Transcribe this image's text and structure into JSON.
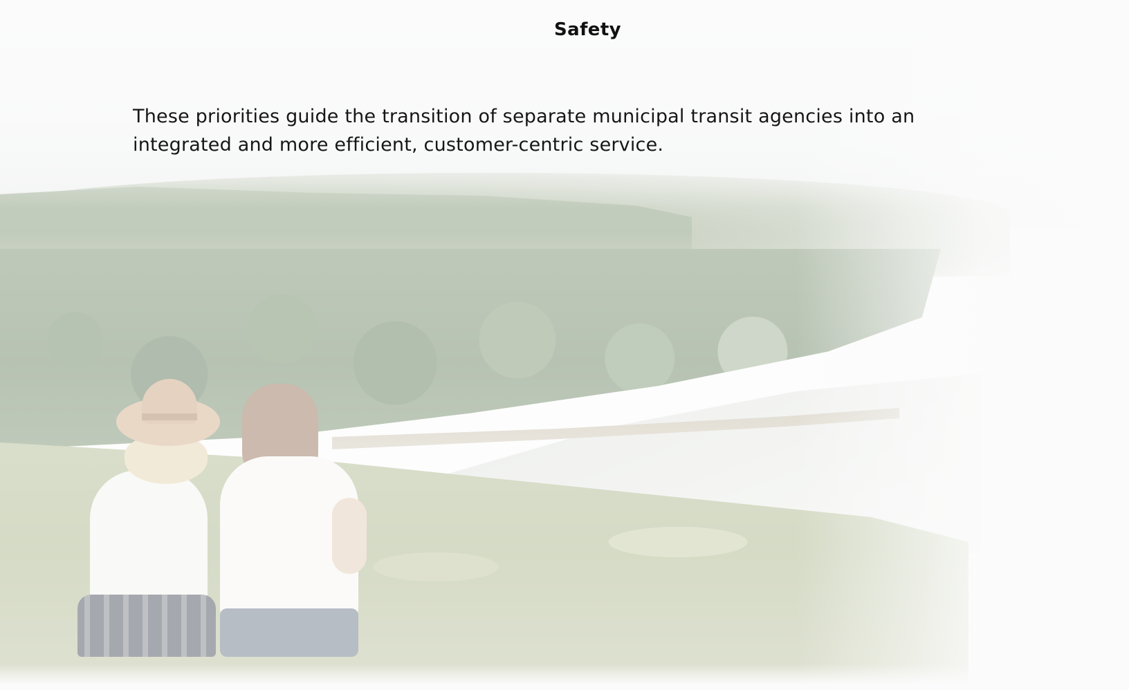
{
  "header": {
    "title": "Safety"
  },
  "body": {
    "intro_text": "These priorities guide the transition of separate municipal transit agencies into an integrated and more efficient, customer-centric service."
  },
  "background": {
    "image_description_icon": "landscape-photo",
    "accent_colors": {
      "forest": "#7d9274",
      "meadow": "#b9c49f",
      "sky": "#eef0f0",
      "page": "#fbfbfb",
      "text": "#111111"
    }
  }
}
